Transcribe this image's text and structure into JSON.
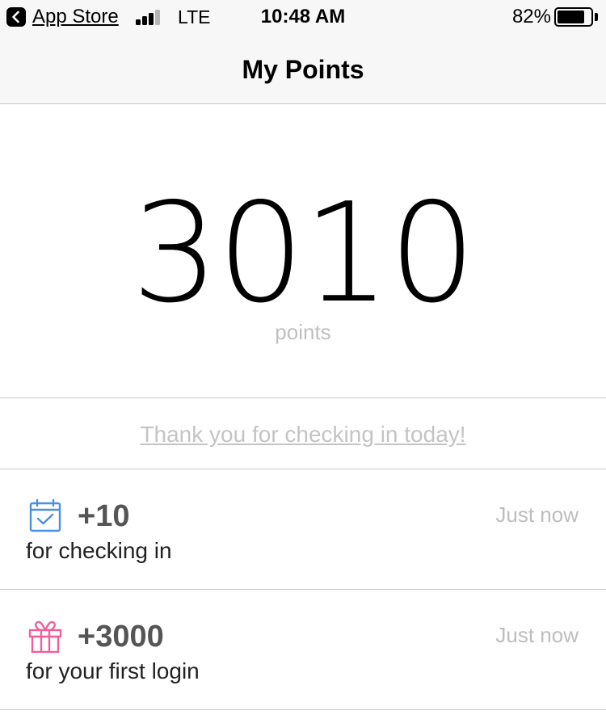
{
  "status_bar": {
    "back_app": "App Store",
    "network": "LTE",
    "time": "10:48 AM",
    "battery_percent": "82%",
    "battery_level": 0.82,
    "signal_bars_active": 3
  },
  "nav": {
    "title": "My Points"
  },
  "points": {
    "value": "3010",
    "unit": "points"
  },
  "banner": {
    "message": "Thank you for checking in today!"
  },
  "activity": [
    {
      "icon": "calendar-check-icon",
      "icon_color": "#4a90e2",
      "amount": "+10",
      "time": "Just now",
      "description": "for checking in"
    },
    {
      "icon": "gift-icon",
      "icon_color": "#f0609e",
      "amount": "+3000",
      "time": "Just now",
      "description": "for your first login"
    }
  ]
}
